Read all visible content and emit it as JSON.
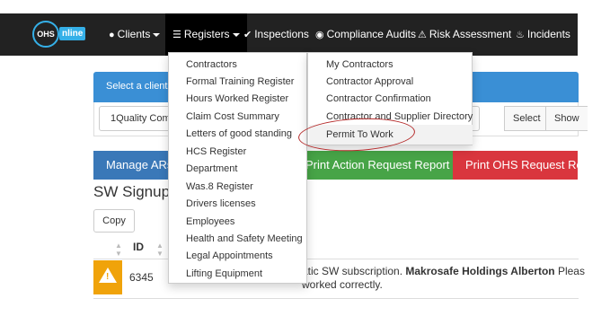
{
  "brand": {
    "circle_text": "OHS",
    "word": "nline"
  },
  "nav": {
    "clients": "Clients",
    "registers": "Registers",
    "inspections": "Inspections",
    "compliance": "Compliance Audits",
    "risk": "Risk Assessment",
    "incidents": "Incidents"
  },
  "panel": {
    "header": "Select a client",
    "client_value": "1Quality Com",
    "select_label": "Select",
    "show_label": "Show"
  },
  "buttons": {
    "manage": "Manage ARs",
    "print_action": "Print Action Request Report",
    "print_ohs": "Print OHS Request Rep"
  },
  "section": {
    "title": "SW Signup",
    "copy": "Copy",
    "id_header": "ID"
  },
  "row": {
    "id": "6345",
    "text_prefix": "atic SW subscription. ",
    "text_bold": "Makrosafe Holdings Alberton",
    "text_suffix": " Pleas",
    "text_line2": "worked correctly."
  },
  "registers_menu": [
    "Contractors",
    "Formal Training Register",
    "Hours Worked Register",
    "Claim Cost Summary",
    "Letters of good standing",
    "HCS Register",
    "Department",
    "Was.8 Register",
    "Drivers licenses",
    "Employees",
    "Health and Safety Meeting",
    "Legal Appointments",
    "Lifting Equipment"
  ],
  "contractors_submenu": [
    "My Contractors",
    "Contractor Approval",
    "Contractor Confirmation",
    "Contractor and Supplier Directory",
    "Permit To Work"
  ],
  "colors": {
    "navbar": "#222222",
    "brand_blue": "#35b0e8",
    "panel_blue": "#3a8fd5",
    "btn_blue": "#3a78b8",
    "btn_green": "#47a447",
    "btn_red": "#d9363e",
    "warning": "#f0a30a",
    "annotation": "#b52a2a"
  },
  "icons": {
    "clients": "user-icon",
    "registers": "list-icon",
    "inspections": "checkmark-icon",
    "compliance": "eye-icon",
    "risk": "warning-icon",
    "incidents": "fire-icon"
  }
}
